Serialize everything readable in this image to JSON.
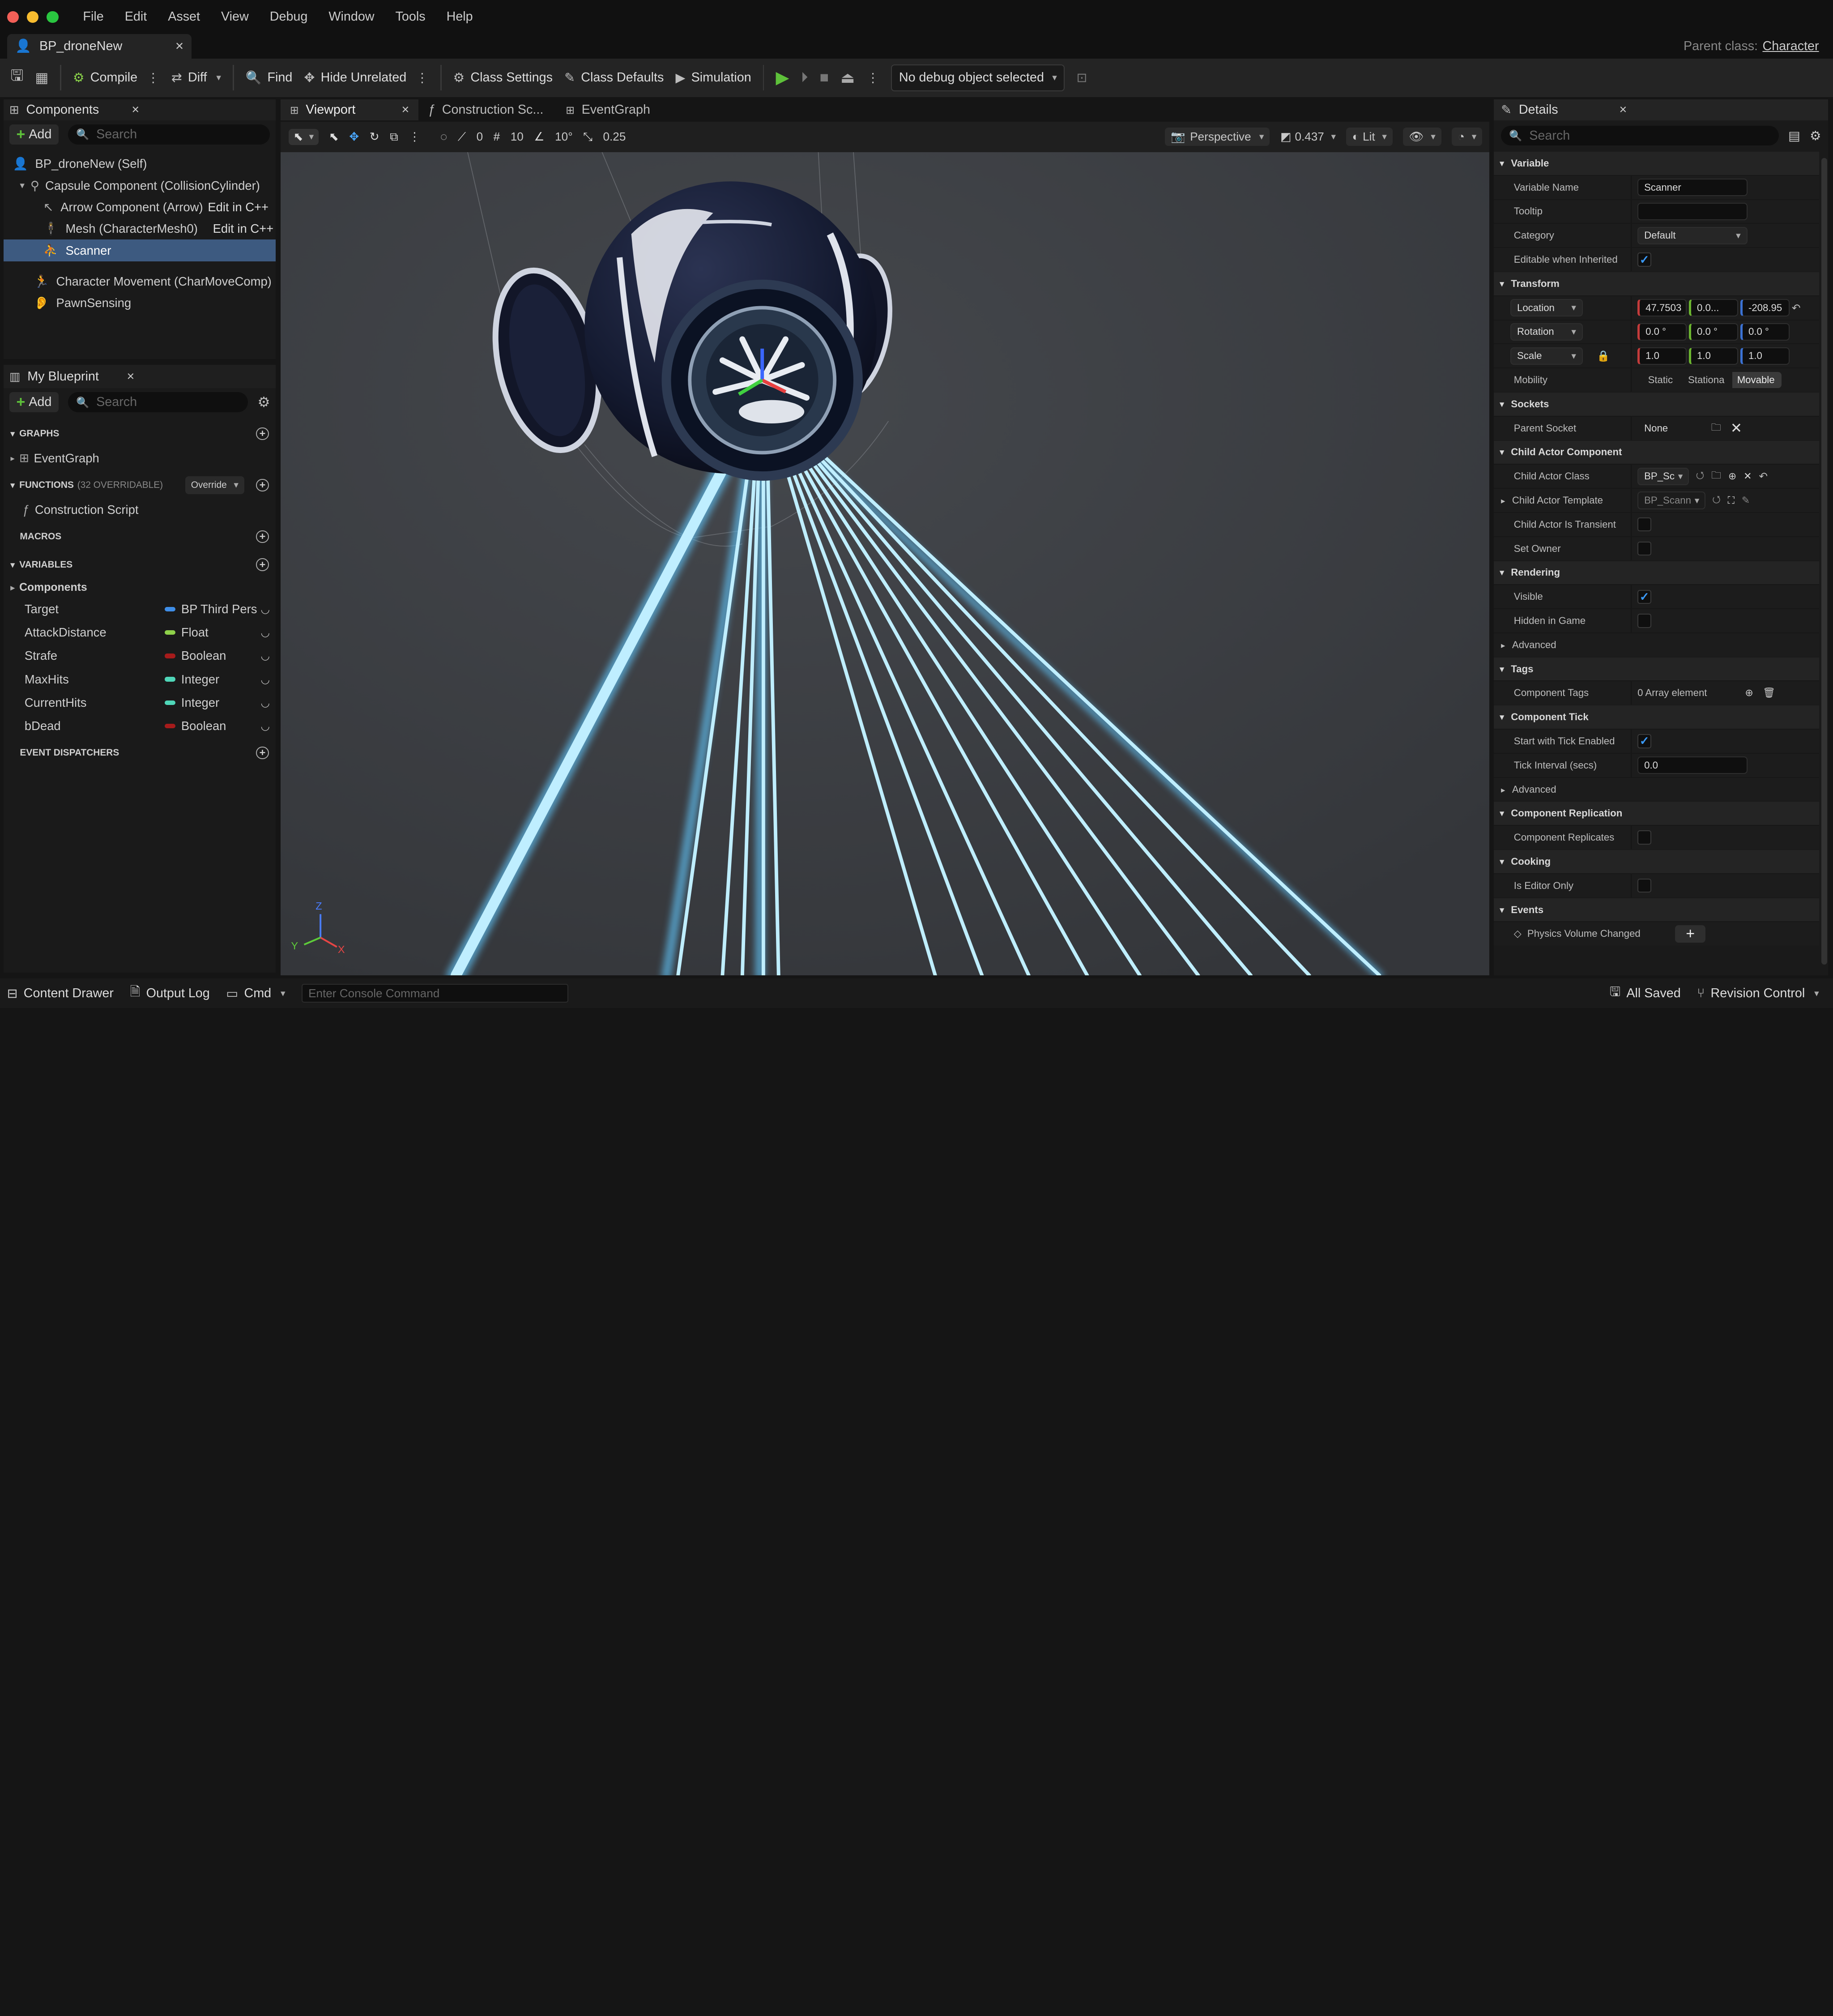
{
  "menu": [
    "File",
    "Edit",
    "Asset",
    "View",
    "Debug",
    "Window",
    "Tools",
    "Help"
  ],
  "doc_tab": {
    "label": "BP_droneNew",
    "close": "×"
  },
  "parent_class": {
    "label": "Parent class:",
    "value": "Character"
  },
  "toolbar": {
    "compile": "Compile",
    "diff": "Diff",
    "find": "Find",
    "hide_unrelated": "Hide Unrelated",
    "class_settings": "Class Settings",
    "class_defaults": "Class Defaults",
    "simulation": "Simulation",
    "debug_select": "No debug object selected"
  },
  "components_panel": {
    "title": "Components",
    "add": "Add",
    "search_placeholder": "Search",
    "items": [
      {
        "label": "BP_droneNew (Self)",
        "indent": 0
      },
      {
        "label": "Capsule Component (CollisionCylinder)",
        "indent": 1
      },
      {
        "label": "Arrow Component (Arrow)",
        "indent": 2,
        "action": "Edit in C++"
      },
      {
        "label": "Mesh (CharacterMesh0)",
        "indent": 2,
        "action": "Edit in C++"
      },
      {
        "label": "Scanner",
        "indent": 2,
        "selected": true
      },
      {
        "label": "Character Movement (CharMoveComp)",
        "indent": 1
      },
      {
        "label": "PawnSensing",
        "indent": 1
      }
    ]
  },
  "blueprint_panel": {
    "title": "My Blueprint",
    "add": "Add",
    "search_placeholder": "Search",
    "graphs": "GRAPHS",
    "event_graph": "EventGraph",
    "functions": "FUNCTIONS",
    "functions_count": "(32 OVERRIDABLE)",
    "override": "Override",
    "construction_script": "Construction Script",
    "macros": "MACROS",
    "variables": "VARIABLES",
    "components_group": "Components",
    "vars": [
      {
        "name": "Target",
        "type": "BP Third Pers",
        "color": "#3f8ee8"
      },
      {
        "name": "AttackDistance",
        "type": "Float",
        "color": "#8fd14a"
      },
      {
        "name": "Strafe",
        "type": "Boolean",
        "color": "#a61b1b"
      },
      {
        "name": "MaxHits",
        "type": "Integer",
        "color": "#4fd6b8"
      },
      {
        "name": "CurrentHits",
        "type": "Integer",
        "color": "#4fd6b8"
      },
      {
        "name": "bDead",
        "type": "Boolean",
        "color": "#a61b1b"
      }
    ],
    "event_dispatchers": "EVENT DISPATCHERS"
  },
  "viewport": {
    "tabs": [
      "Viewport",
      "Construction Sc...",
      "EventGraph"
    ],
    "snap_angle": "0",
    "grid": "10",
    "rot": "10°",
    "scale": "0.25",
    "perspective": "Perspective",
    "fov": "0.437",
    "lit": "Lit",
    "axis_z": "Z",
    "axis_x": "X",
    "axis_y": "Y"
  },
  "details": {
    "title": "Details",
    "search_placeholder": "Search",
    "variable": {
      "header": "Variable",
      "name_label": "Variable Name",
      "name_value": "Scanner",
      "tooltip": "Tooltip",
      "category": "Category",
      "category_value": "Default",
      "editable": "Editable when Inherited"
    },
    "transform": {
      "header": "Transform",
      "location": "Location",
      "loc": [
        "47.7503",
        "0.0...",
        "-208.95"
      ],
      "rotation": "Rotation",
      "rot": [
        "0.0 °",
        "0.0 °",
        "0.0 °"
      ],
      "scale": "Scale",
      "scl": [
        "1.0",
        "1.0",
        "1.0"
      ],
      "mobility": "Mobility",
      "mob": [
        "Static",
        "Stationa",
        "Movable"
      ]
    },
    "sockets": {
      "header": "Sockets",
      "parent": "Parent Socket",
      "value": "None"
    },
    "child_actor": {
      "header": "Child Actor Component",
      "cls": "Child Actor Class",
      "cls_value": "BP_Sc",
      "tmpl": "Child Actor Template",
      "tmpl_value": "BP_Scann",
      "transient": "Child Actor Is Transient",
      "owner": "Set Owner"
    },
    "rendering": {
      "header": "Rendering",
      "visible": "Visible",
      "hidden": "Hidden in Game",
      "advanced": "Advanced"
    },
    "tags": {
      "header": "Tags",
      "label": "Component Tags",
      "value": "0 Array element"
    },
    "tick": {
      "header": "Component Tick",
      "start": "Start with Tick Enabled",
      "interval": "Tick Interval (secs)",
      "interval_value": "0.0",
      "advanced": "Advanced"
    },
    "replication": {
      "header": "Component Replication",
      "label": "Component Replicates"
    },
    "cooking": {
      "header": "Cooking",
      "label": "Is Editor Only"
    },
    "events": {
      "header": "Events",
      "label": "Physics Volume Changed"
    }
  },
  "statusbar": {
    "content_drawer": "Content Drawer",
    "output_log": "Output Log",
    "cmd": "Cmd",
    "console_placeholder": "Enter Console Command",
    "all_saved": "All Saved",
    "revision": "Revision Control"
  },
  "colors": {
    "accent_select": "#3d5a80",
    "play_green": "#5ec13a",
    "beam": "#8fd8ff"
  }
}
